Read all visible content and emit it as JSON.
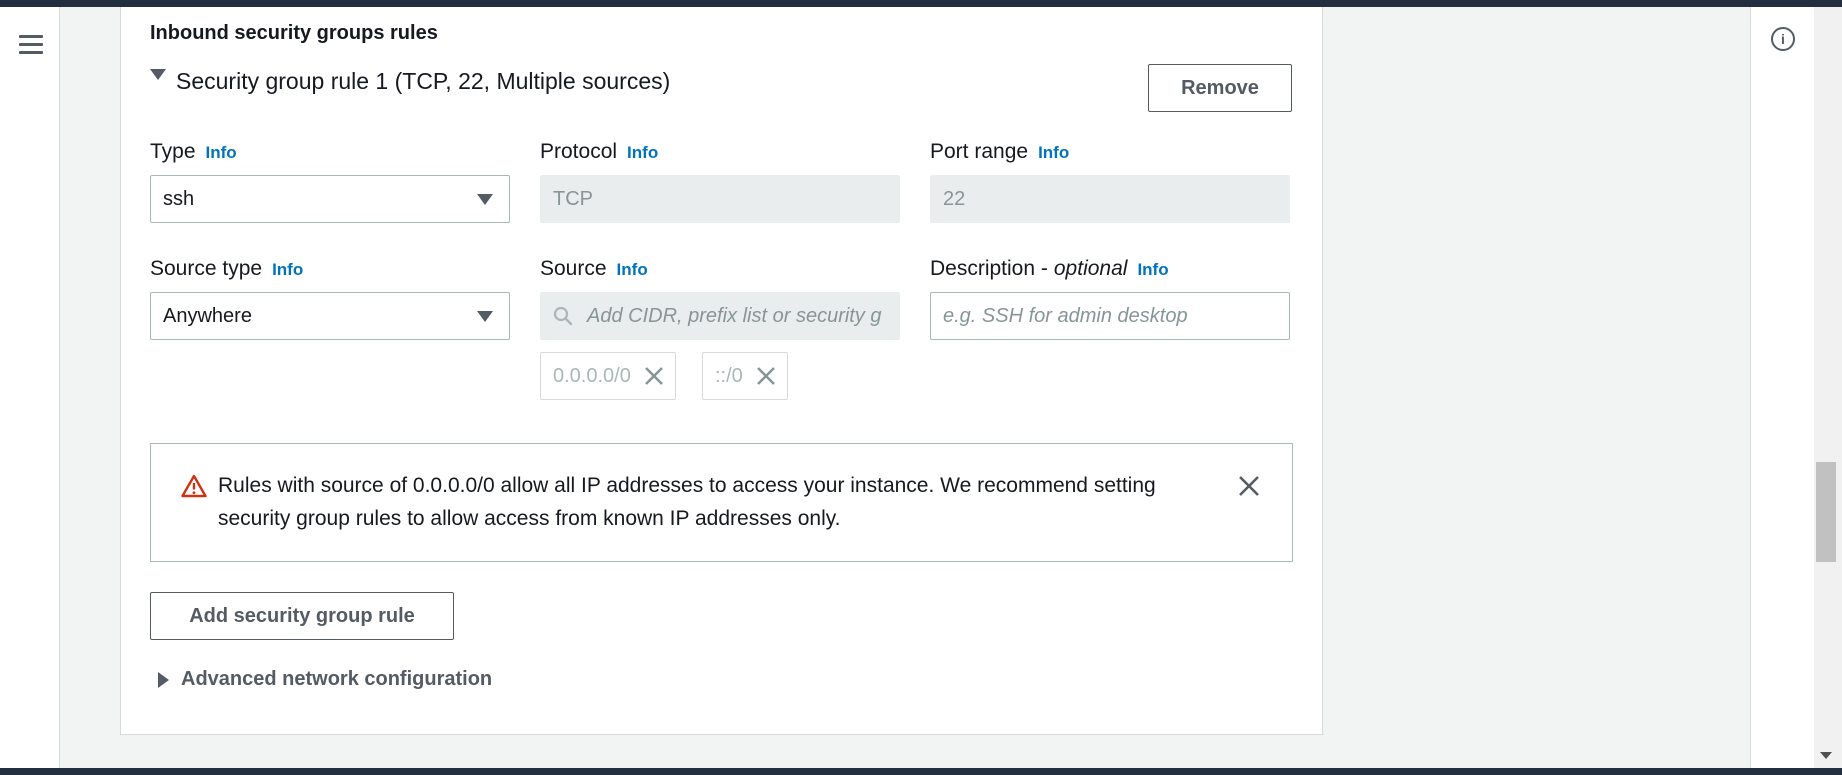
{
  "section": {
    "title": "Inbound security groups rules"
  },
  "rule": {
    "header": "Security group rule 1 (TCP, 22, Multiple sources)",
    "remove_label": "Remove",
    "type_label": "Type",
    "type_value": "ssh",
    "protocol_label": "Protocol",
    "protocol_value": "TCP",
    "port_range_label": "Port range",
    "port_range_value": "22",
    "source_type_label": "Source type",
    "source_type_value": "Anywhere",
    "source_label": "Source",
    "source_placeholder": "Add CIDR, prefix list or security g",
    "source_tokens": [
      "0.0.0.0/0",
      "::/0"
    ],
    "description_label": "Description -",
    "description_optional": "optional",
    "description_placeholder": "e.g. SSH for admin desktop",
    "info_link": "Info"
  },
  "warning": {
    "text": "Rules with source of 0.0.0.0/0 allow all IP addresses to access your instance. We recommend setting security group rules to allow access from known IP addresses only."
  },
  "actions": {
    "add_rule_label": "Add security group rule",
    "advanced_label": "Advanced network configuration"
  },
  "icons": {
    "menu": "hamburger-menu-icon",
    "info": "info-circle-icon",
    "search": "search-icon",
    "warning": "warning-triangle-icon",
    "close": "close-icon"
  },
  "colors": {
    "info_link": "#0073bb",
    "warning_icon": "#d13212",
    "topbar": "#232f3e"
  }
}
